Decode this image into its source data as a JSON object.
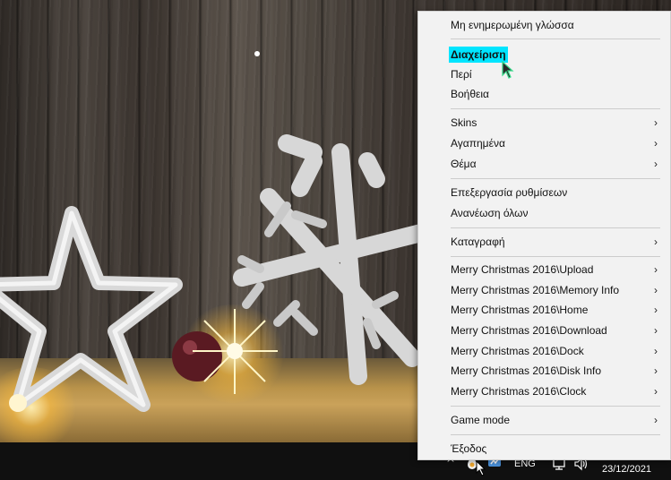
{
  "menu": {
    "items": [
      {
        "label": "Μη ενημερωμένη γλώσσα",
        "submenu": false
      },
      {
        "label": "Διαχείριση",
        "submenu": false,
        "highlighted": true
      },
      {
        "label": "Περί",
        "submenu": false
      },
      {
        "label": "Βοήθεια",
        "submenu": false
      },
      {
        "label": "Skins",
        "submenu": true
      },
      {
        "label": "Αγαπημένα",
        "submenu": true
      },
      {
        "label": "Θέμα",
        "submenu": true
      },
      {
        "label": "Επεξεργασία ρυθμίσεων",
        "submenu": false
      },
      {
        "label": "Ανανέωση όλων",
        "submenu": false
      },
      {
        "label": "Καταγραφή",
        "submenu": true
      },
      {
        "label": "Merry Christmas 2016\\Upload",
        "submenu": true
      },
      {
        "label": "Merry Christmas 2016\\Memory Info",
        "submenu": true
      },
      {
        "label": "Merry Christmas 2016\\Home",
        "submenu": true
      },
      {
        "label": "Merry Christmas 2016\\Download",
        "submenu": true
      },
      {
        "label": "Merry Christmas 2016\\Dock",
        "submenu": true
      },
      {
        "label": "Merry Christmas 2016\\Disk Info",
        "submenu": true
      },
      {
        "label": "Merry Christmas 2016\\Clock",
        "submenu": true
      },
      {
        "label": "Game mode",
        "submenu": true
      },
      {
        "label": "Έξοδος",
        "submenu": false
      }
    ],
    "submenu_arrow": "›",
    "highlight_color": "#00e5ff"
  },
  "taskbar": {
    "chevron": "^",
    "language": "ENG",
    "date": "23/12/2021",
    "icons": [
      "rainmeter-tray-icon",
      "app-tray-icon",
      "network-icon",
      "volume-icon"
    ]
  }
}
